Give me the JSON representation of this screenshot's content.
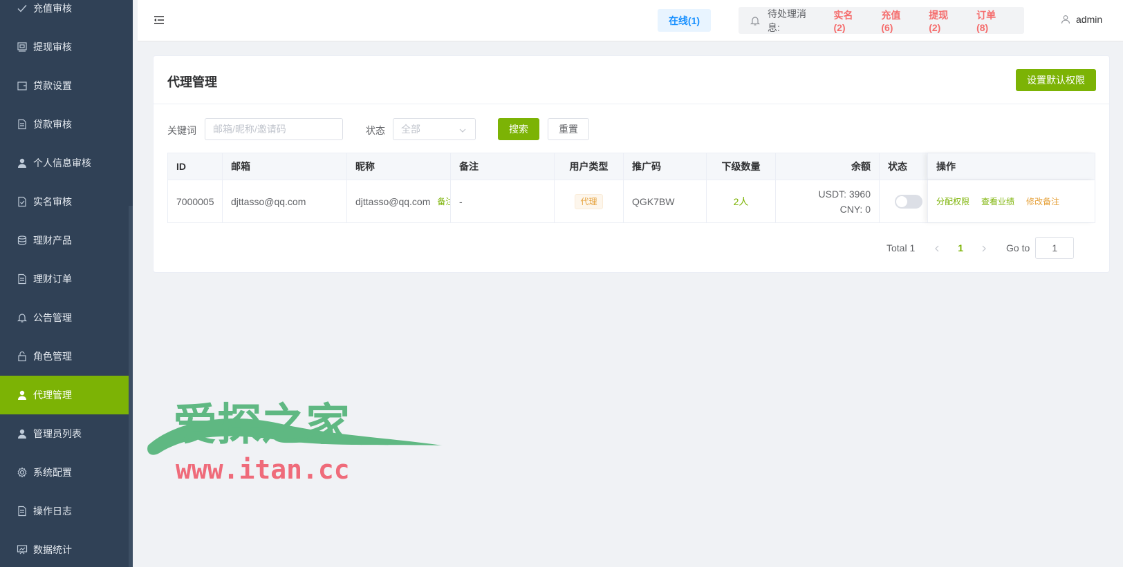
{
  "sidebar": {
    "items": [
      {
        "label": "充值审核",
        "icon": "check-icon"
      },
      {
        "label": "提现审核",
        "icon": "wallet-icon"
      },
      {
        "label": "贷款设置",
        "icon": "purse-icon"
      },
      {
        "label": "贷款审核",
        "icon": "document-icon"
      },
      {
        "label": "个人信息审核",
        "icon": "user-icon"
      },
      {
        "label": "实名审核",
        "icon": "document-check-icon"
      },
      {
        "label": "理财产品",
        "icon": "coins-icon"
      },
      {
        "label": "理财订单",
        "icon": "document-icon"
      },
      {
        "label": "公告管理",
        "icon": "bell-icon"
      },
      {
        "label": "角色管理",
        "icon": "lock-icon"
      },
      {
        "label": "代理管理",
        "icon": "user-icon",
        "active": true
      },
      {
        "label": "管理员列表",
        "icon": "user-icon"
      },
      {
        "label": "系统配置",
        "icon": "gear-icon"
      },
      {
        "label": "操作日志",
        "icon": "document-icon"
      },
      {
        "label": "数据统计",
        "icon": "chart-icon"
      }
    ],
    "colors": {
      "background": "#304156",
      "active": "#7cb305"
    }
  },
  "header": {
    "online": "在线(1)",
    "notice_label": "待处理消息:",
    "notices": [
      "实名(2)",
      "充值(6)",
      "提现(2)",
      "订单(8)"
    ],
    "user": "admin"
  },
  "card": {
    "title": "代理管理",
    "default_perm_button": "设置默认权限"
  },
  "filter": {
    "keyword_label": "关键词",
    "keyword_placeholder": "邮箱/昵称/邀请码",
    "status_label": "状态",
    "status_value": "全部",
    "search_button": "搜索",
    "reset_button": "重置"
  },
  "table": {
    "columns": [
      "ID",
      "邮箱",
      "昵称",
      "备注",
      "用户类型",
      "推广码",
      "下级数量",
      "余额",
      "状态",
      "操作"
    ],
    "rows": [
      {
        "id": "7000005",
        "email": "djttasso@qq.com",
        "nickname": "djttasso@qq.com",
        "nickname_link": "备注",
        "remark": "-",
        "user_type": "代理",
        "promo_code": "QGK7BW",
        "sub_count": "2人",
        "balance_usdt": "USDT: 3960",
        "balance_cny": "CNY: 0",
        "actions": [
          "分配权限",
          "查看业绩",
          "修改备注"
        ]
      }
    ]
  },
  "pagination": {
    "total": "Total 1",
    "current_page": "1",
    "goto_label": "Go to",
    "goto_value": "1"
  },
  "watermark": {
    "title": "爱探之家",
    "url": "www.itan.cc"
  },
  "colors": {
    "accent": "#7cb305",
    "danger": "#f56c6c",
    "warning": "#e6a23c",
    "info": "#1890ff"
  }
}
